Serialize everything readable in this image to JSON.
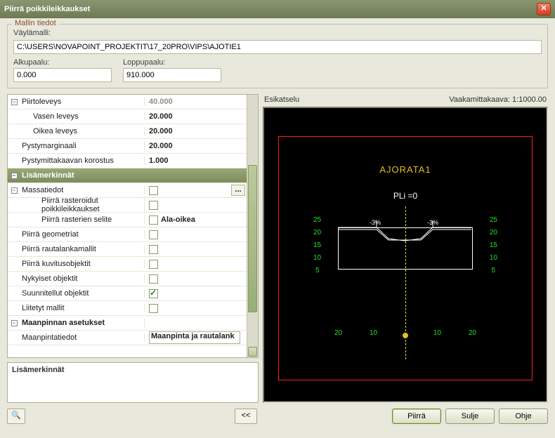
{
  "title": "Piirrä poikkileikkaukset",
  "model": {
    "legend": "Mallin tiedot",
    "path_label": "Väylämalli:",
    "path": "C:\\USERS\\NOVAPOINT_PROJEKTIT\\17_20PRO\\VIPS\\AJOTIE1",
    "start_label": "Alkupaalu:",
    "start": "0.000",
    "end_label": "Loppupaalu:",
    "end": "910.000"
  },
  "grid": {
    "rows": [
      {
        "type": "exp",
        "name": "Piirtoleveys",
        "val": "40.000",
        "dim": true
      },
      {
        "type": "val",
        "ind": 1,
        "name": "Vasen leveys",
        "val": "20.000"
      },
      {
        "type": "val",
        "ind": 1,
        "name": "Oikea leveys",
        "val": "20.000"
      },
      {
        "type": "val",
        "ind": 0,
        "name": "Pystymarginaali",
        "val": "20.000"
      },
      {
        "type": "val",
        "ind": 0,
        "name": "Pystymittakaavan korostus",
        "val": "1.000"
      },
      {
        "type": "hdr",
        "name": "Lisämerkinnät"
      },
      {
        "type": "cb",
        "name": "Massatiedot",
        "checked": false,
        "dots": true
      },
      {
        "type": "cb",
        "ind": 2,
        "name": "Piirrä rasteroidut poikkileikkaukset",
        "checked": false
      },
      {
        "type": "cbtxt",
        "ind": 2,
        "name": "Piirrä rasterien selite",
        "checked": false,
        "txt": "Ala-oikea"
      },
      {
        "type": "cb",
        "ind": 0,
        "name": "Piirrä geometriat",
        "checked": false
      },
      {
        "type": "cb",
        "ind": 0,
        "name": "Piirrä rautalankamallit",
        "checked": false
      },
      {
        "type": "cb",
        "ind": 0,
        "name": "Piirrä kuvitusobjektit",
        "checked": false
      },
      {
        "type": "cb",
        "ind": 0,
        "name": "Nykyiset objektit",
        "checked": false
      },
      {
        "type": "cb",
        "ind": 0,
        "name": "Suunnitellut objektit",
        "checked": true
      },
      {
        "type": "cb",
        "ind": 0,
        "name": "Liitetyt mallit",
        "checked": false
      },
      {
        "type": "exp",
        "name": "Maanpinnan asetukset",
        "val": ""
      },
      {
        "type": "sel",
        "ind": 0,
        "name": "Maanpintatiedot",
        "val": "Maanpinta ja rautalank"
      }
    ]
  },
  "description_title": "Lisämerkinnät",
  "preview": {
    "label": "Esikatselu",
    "scale_label": "Vaakamittakaava: 1:1000.00",
    "title1": "AJORATA1",
    "title2": "PLi =0",
    "y_ticks": [
      "25",
      "20",
      "15",
      "10",
      "5"
    ],
    "x_ticks_neg": [
      "20",
      "10"
    ],
    "x_ticks_pos": [
      "10",
      "20"
    ],
    "x_zero": "0"
  },
  "buttons": {
    "collapse": "<<",
    "draw": "Piirrä",
    "close": "Sulje",
    "help": "Ohje"
  }
}
